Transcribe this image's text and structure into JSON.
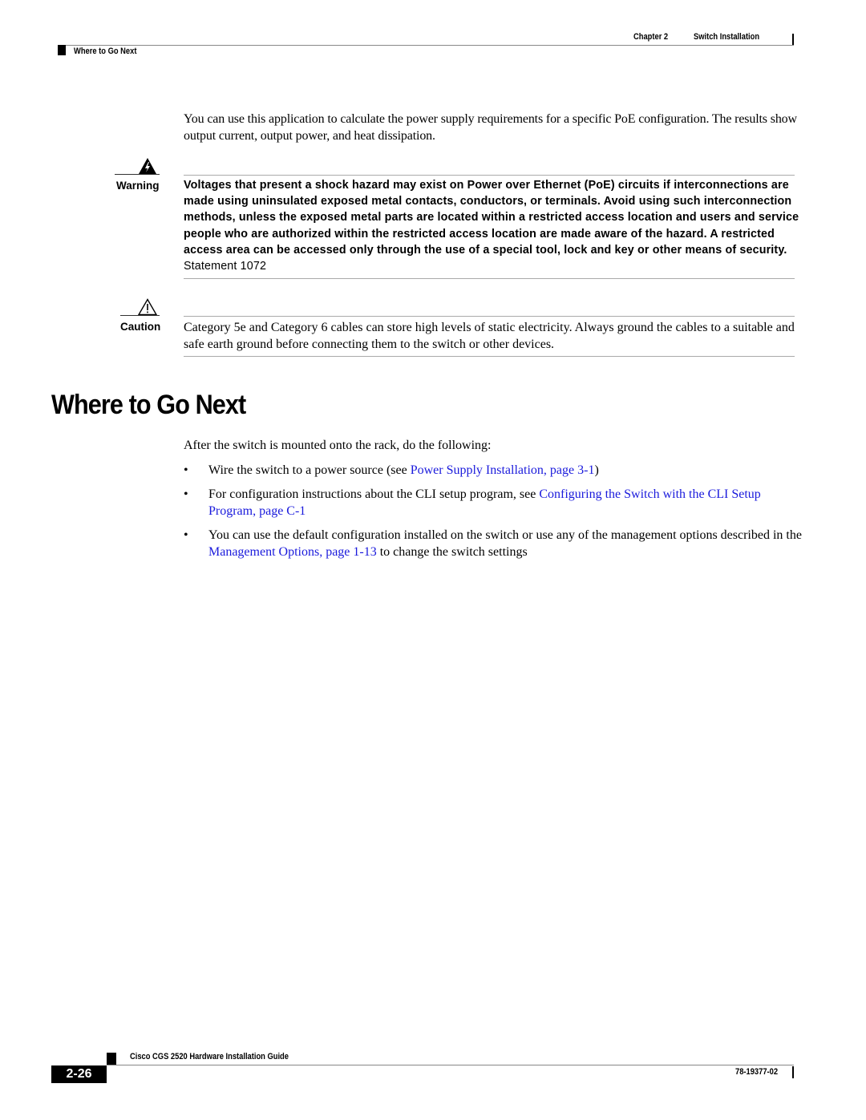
{
  "header": {
    "chapter": "Chapter 2",
    "chapter_title": "Switch Installation",
    "section": "Where to Go Next"
  },
  "intro": "You can use this application to calculate the power supply requirements for a specific PoE configuration. The results show output current, output power, and heat dissipation.",
  "warning": {
    "icon": "warning-shock-icon",
    "label": "Warning",
    "bold_text": "Voltages that present a shock hazard may exist on Power over Ethernet (PoE) circuits if interconnections are made using uninsulated exposed metal contacts, conductors, or terminals. Avoid using such interconnection methods, unless the exposed metal parts are located within a restricted access location and users and service people who are authorized within the restricted access location are made aware of the hazard. A restricted access area can be accessed only through the use of a special tool, lock and key or other means of security.",
    "statement": " Statement 1072"
  },
  "caution": {
    "icon": "caution-icon",
    "label": "Caution",
    "text": "Category 5e and Category 6 cables can store high levels of static electricity. Always ground the cables to a suitable and safe earth ground before connecting them to the switch or other devices."
  },
  "section": {
    "heading": "Where to Go Next",
    "lead": "After the switch is mounted onto the rack, do the following:",
    "bullets": [
      {
        "before": "Wire the switch to a power source (see ",
        "link": "Power Supply Installation, page 3-1",
        "after": ")"
      },
      {
        "before": "For configuration instructions about the CLI setup program, see ",
        "link": "Configuring the Switch with the CLI Setup Program, page C-1",
        "after": ""
      },
      {
        "before": "You can use the default configuration installed on the switch or use any of the management options described in the ",
        "link": "Management Options, page 1-13",
        "after": " to change the switch settings"
      }
    ]
  },
  "footer": {
    "guide_title": "Cisco CGS 2520 Hardware Installation Guide",
    "page_number": "2-26",
    "doc_number": "78-19377-02"
  },
  "colors": {
    "link": "#1a1adc"
  }
}
